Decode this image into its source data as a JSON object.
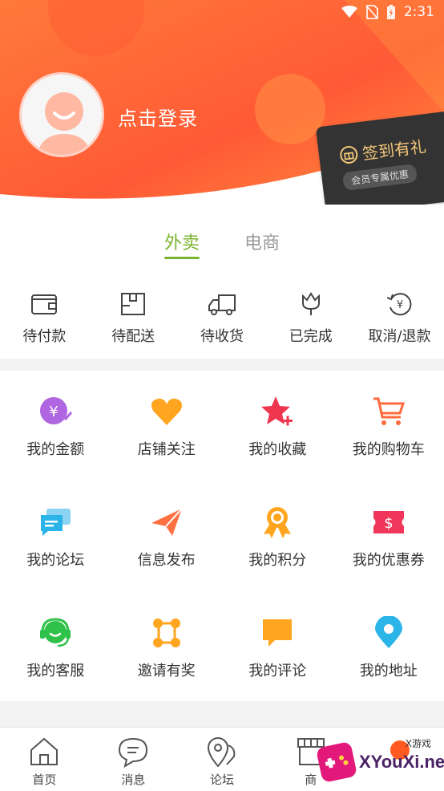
{
  "status_bar": {
    "time": "2:31"
  },
  "profile": {
    "login_text": "点击登录"
  },
  "signin_card": {
    "title": "签到有礼",
    "subtitle": "会员专属优惠"
  },
  "tabs": [
    {
      "label": "外卖",
      "active": true
    },
    {
      "label": "电商",
      "active": false
    }
  ],
  "orders": [
    {
      "label": "待付款",
      "icon": "wallet-icon"
    },
    {
      "label": "待配送",
      "icon": "package-icon"
    },
    {
      "label": "待收货",
      "icon": "truck-icon"
    },
    {
      "label": "已完成",
      "icon": "flower-icon"
    },
    {
      "label": "取消/退款",
      "icon": "refund-icon"
    }
  ],
  "grid": [
    {
      "label": "我的金额",
      "icon": "money-icon",
      "color": "#b066e0"
    },
    {
      "label": "店铺关注",
      "icon": "heart-icon",
      "color": "#ffa51f"
    },
    {
      "label": "我的收藏",
      "icon": "star-icon",
      "color": "#f0364f"
    },
    {
      "label": "我的购物车",
      "icon": "cart-icon",
      "color": "#ff6b3d"
    },
    {
      "label": "我的论坛",
      "icon": "chat-icon",
      "color": "#2ab4e8"
    },
    {
      "label": "信息发布",
      "icon": "paper-plane-icon",
      "color": "#ff7043"
    },
    {
      "label": "我的积分",
      "icon": "medal-icon",
      "color": "#ffa51f"
    },
    {
      "label": "我的优惠券",
      "icon": "coupon-icon",
      "color": "#f0365a"
    },
    {
      "label": "我的客服",
      "icon": "headset-icon",
      "color": "#2fc149"
    },
    {
      "label": "邀请有奖",
      "icon": "network-icon",
      "color": "#ffa51f"
    },
    {
      "label": "我的评论",
      "icon": "comment-icon",
      "color": "#ffa51f"
    },
    {
      "label": "我的地址",
      "icon": "location-icon",
      "color": "#2ab4e8"
    }
  ],
  "bottom_nav": [
    {
      "label": "首页",
      "icon": "home-icon"
    },
    {
      "label": "消息",
      "icon": "message-icon"
    },
    {
      "label": "论坛",
      "icon": "forum-icon"
    },
    {
      "label": "商",
      "icon": "shop-icon"
    },
    {
      "label": "",
      "icon": "profile-icon"
    }
  ],
  "watermark": {
    "text": "XYouXi.net",
    "small": "X游戏"
  }
}
